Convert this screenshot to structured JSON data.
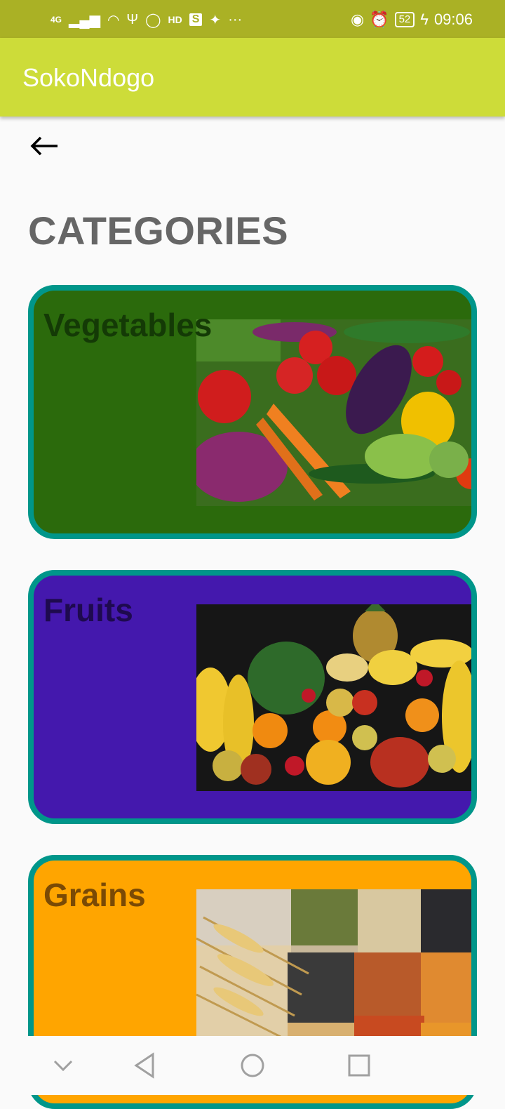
{
  "status_bar": {
    "network": "4G",
    "hd_label": "HD",
    "s_label": "S",
    "more": "···",
    "battery": "52",
    "time": "09:06"
  },
  "app_bar": {
    "title": "SokoNdogo"
  },
  "page": {
    "heading": "CATEGORIES"
  },
  "categories": [
    {
      "label": "Vegetables",
      "bg": "#2b6a0c",
      "label_color": "#143a06",
      "image": "vegetables-photo"
    },
    {
      "label": "Fruits",
      "bg": "#4418ad",
      "label_color": "#1e0a4f",
      "image": "fruits-photo"
    },
    {
      "label": "Grains",
      "bg": "#ffa500",
      "label_color": "#7a4a05",
      "image": "grains-photo"
    }
  ],
  "colors": {
    "status_bar": "#aab125",
    "app_bar": "#cddc39",
    "card_border": "#00968a",
    "heading": "#666666"
  }
}
